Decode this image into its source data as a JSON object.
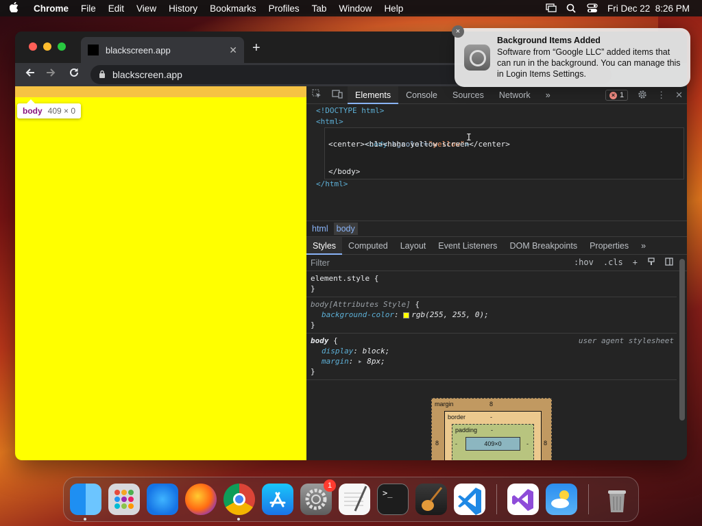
{
  "menubar": {
    "app": "Chrome",
    "items": [
      "File",
      "Edit",
      "View",
      "History",
      "Bookmarks",
      "Profiles",
      "Tab",
      "Window",
      "Help"
    ],
    "datetime": "Fri Dec 22  8:26 PM"
  },
  "browser": {
    "tab_title": "blackscreen.app",
    "url": "blackscreen.app"
  },
  "page": {
    "background": "#ffff00",
    "tooltip_tag": "body",
    "tooltip_dims": "409 × 0"
  },
  "devtools": {
    "tabs": [
      "Elements",
      "Console",
      "Sources",
      "Network"
    ],
    "more": "»",
    "error_count": "1",
    "code": {
      "doctype": "<!DOCTYPE html>",
      "html_open": "<html>",
      "body_open_tag": "<body",
      "body_attr": " bgcolor=",
      "body_val": "\"yellow\"",
      "body_close_bracket": ">",
      "center_line": "<center><h1><haha yellow screen</center>",
      "body_close": "</body>",
      "html_close": "</html>"
    },
    "breadcrumbs": [
      "html",
      "body"
    ],
    "subtabs": [
      "Styles",
      "Computed",
      "Layout",
      "Event Listeners",
      "DOM Breakpoints",
      "Properties"
    ],
    "filter_placeholder": "Filter",
    "filter_tools": [
      ":hov",
      ".cls",
      "+"
    ],
    "rules": {
      "r1_selector": "element.style {",
      "r1_close": "}",
      "r2_selector": "body[Attributes Style]",
      "r2_brace": " {",
      "r2_prop": "background-color",
      "r2_val": "rgb(255, 255, 0);",
      "r2_close": "}",
      "r3_selector": "body",
      "r3_brace": " {",
      "r3_source": "user agent stylesheet",
      "r3_p1": "display",
      "r3_v1": "block;",
      "r3_p2": "margin",
      "r3_v2": "8px;",
      "r3_close": "}"
    },
    "box_model": {
      "margin_label": "margin",
      "margin_top": "8",
      "margin_left": "8",
      "margin_right": "8",
      "border_label": "border",
      "border_val": "-",
      "padding_label": "padding",
      "padding_val": "-",
      "content": "409×0",
      "dash": "-"
    }
  },
  "notification": {
    "title": "Background Items Added",
    "body": "Software from “Google LLC” added items that can run in the background. You can manage this in Login Items Settings."
  },
  "dock": {
    "apps": [
      "Finder",
      "Launchpad",
      "Safari",
      "Firefox",
      "Google Chrome",
      "App Store",
      "System Settings",
      "TextEdit",
      "Terminal",
      "GarageBand",
      "Visual Studio Code",
      "Visual Studio",
      "Weather",
      "Trash"
    ],
    "settings_badge": "1"
  }
}
